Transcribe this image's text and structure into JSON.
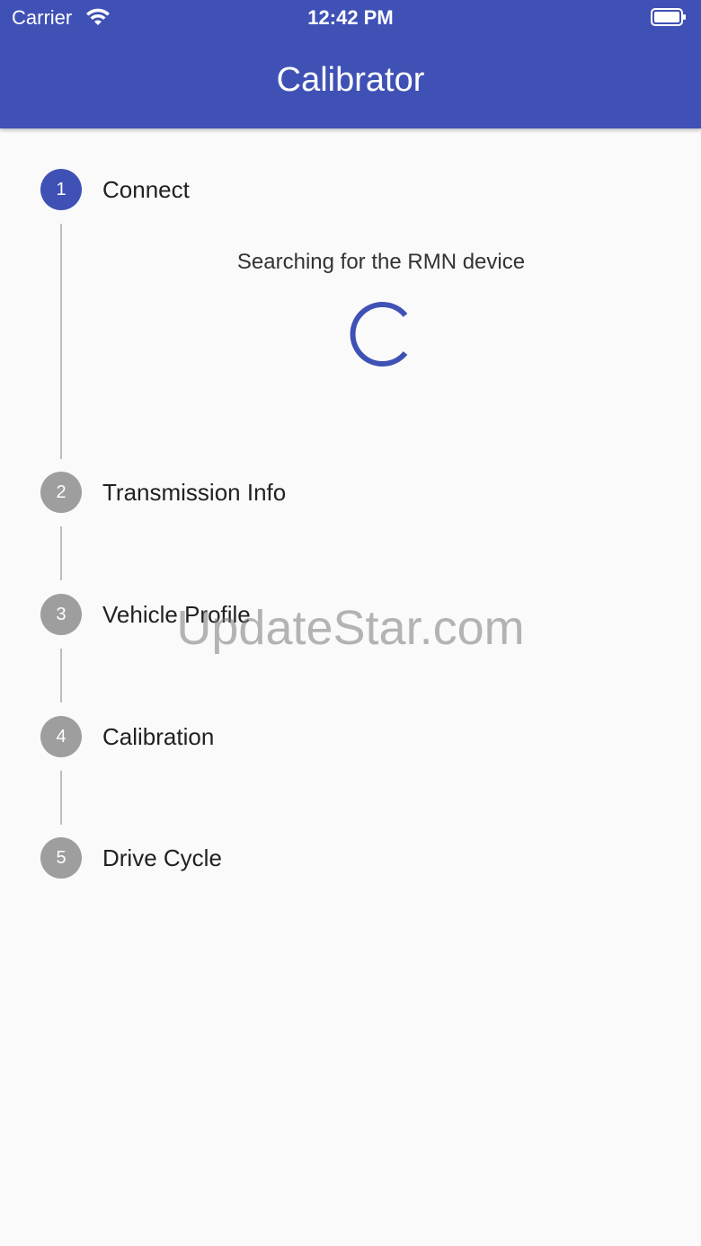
{
  "status_bar": {
    "carrier": "Carrier",
    "time": "12:42 PM"
  },
  "app_bar": {
    "title": "Calibrator",
    "color": "#3f51b5"
  },
  "stepper": {
    "steps": [
      {
        "number": "1",
        "label": "Connect",
        "state": "active"
      },
      {
        "number": "2",
        "label": "Transmission Info",
        "state": "inactive"
      },
      {
        "number": "3",
        "label": "Vehicle Profile",
        "state": "inactive"
      },
      {
        "number": "4",
        "label": "Calibration",
        "state": "inactive"
      },
      {
        "number": "5",
        "label": "Drive Cycle",
        "state": "inactive"
      }
    ],
    "active_content": {
      "message": "Searching for the RMN device",
      "spinner_icon": "loading-spinner-icon"
    }
  },
  "watermark": "UpdateStar.com",
  "colors": {
    "accent": "#3f51b5",
    "inactive": "#9e9e9e",
    "connector": "#bdbdbd",
    "background": "#fafafa"
  }
}
